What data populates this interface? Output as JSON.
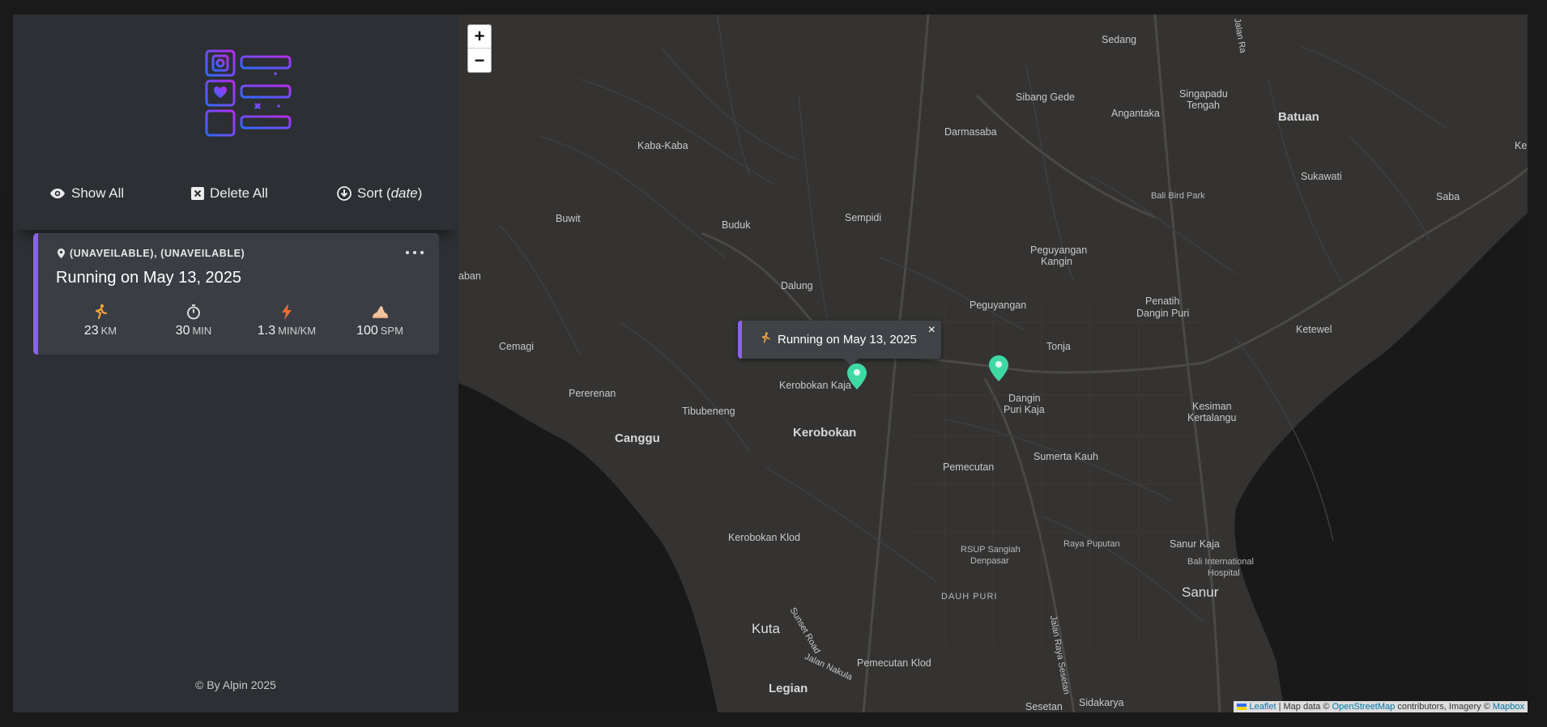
{
  "sidebar": {
    "controls": {
      "show_all": "Show All",
      "delete_all": "Delete All",
      "sort_prefix": "Sort (",
      "sort_field": "date",
      "sort_suffix": ")"
    },
    "workout": {
      "location": "(UNAVEILABLE), (UNAVEILABLE)",
      "title": "Running on May 13, 2025",
      "stats": [
        {
          "icon": "running-icon",
          "value": "23",
          "unit": "KM"
        },
        {
          "icon": "stopwatch-icon",
          "value": "30",
          "unit": "MIN"
        },
        {
          "icon": "lightning-icon",
          "value": "1.3",
          "unit": "MIN/KM"
        },
        {
          "icon": "foot-icon",
          "value": "100",
          "unit": "SPM"
        }
      ]
    },
    "footer": "© By Alpin 2025"
  },
  "map": {
    "zoom_in": "+",
    "zoom_out": "−",
    "popup": {
      "title": "Running on May 13, 2025",
      "close": "×"
    },
    "labels": {
      "sedang": "Sedang",
      "jalan_ra": "Jalan Ra",
      "sibang_gede": "Sibang Gede",
      "singapadu": "Singapadu",
      "tengah": "Tengah",
      "angantaka": "Angantaka",
      "batuan": "Batuan",
      "darmasaba": "Darmasaba",
      "kaba_kaba": "Kaba-Kaba",
      "sukawati": "Sukawati",
      "bali_bird_park": "Bali Bird Park",
      "saba": "Saba",
      "ke": "Ke",
      "buwit": "Buwit",
      "buduk": "Buduk",
      "sempidi": "Sempidi",
      "peguyangan_kangin_1": "Peguyangan",
      "peguyangan_kangin_2": "Kangin",
      "aban": "aban",
      "dalung": "Dalung",
      "peguyangan": "Peguyangan",
      "penatih_1": "Penatih",
      "penatih_2": "Dangin Puri",
      "ketewel": "Ketewel",
      "cemagi": "Cemagi",
      "tonja": "Tonja",
      "kerobokan_kaja": "Kerobokan Kaja",
      "pererenan": "Pererenan",
      "dangin_1": "Dangin",
      "dangin_2": "Puri Kaja",
      "kesiman_1": "Kesiman",
      "kesiman_2": "Kertalangu",
      "tibubeneng": "Tibubeneng",
      "canggu": "Canggu",
      "kerobokan": "Kerobokan",
      "sumerta_kauh": "Sumerta Kauh",
      "pemecutan": "Pemecutan",
      "kerobokan_klod": "Kerobokan Klod",
      "rsup_1": "RSUP Sangiah",
      "rsup_2": "Denpasar",
      "raya_puputan": "Raya Puputan",
      "sanur_kaja": "Sanur Kaja",
      "bali_intl_1": "Bali International",
      "bali_intl_2": "Hospital",
      "sanur": "Sanur",
      "dauh_puri": "DAUH PURI",
      "kuta": "Kuta",
      "sunset_road": "Sunset Road",
      "jalan_raya_sesetan": "Jalan Raya Sesetan",
      "jalan_nakula": "Jalan Nakula",
      "pemecutan_klod": "Pemecutan Klod",
      "legian": "Legian",
      "sesetan": "Sesetan",
      "sidakarya": "Sidakarya"
    },
    "attribution": {
      "leaflet": "Leaflet",
      "map_data": " | Map data © ",
      "osm": "OpenStreetMap",
      "contrib": " contributors, Imagery © ",
      "mapbox": "Mapbox"
    }
  },
  "colors": {
    "accent": "#8b63e6",
    "marker": "#3fd9a4",
    "sidebar_bg": "#2c2f33",
    "card_bg": "#3a3e44"
  }
}
